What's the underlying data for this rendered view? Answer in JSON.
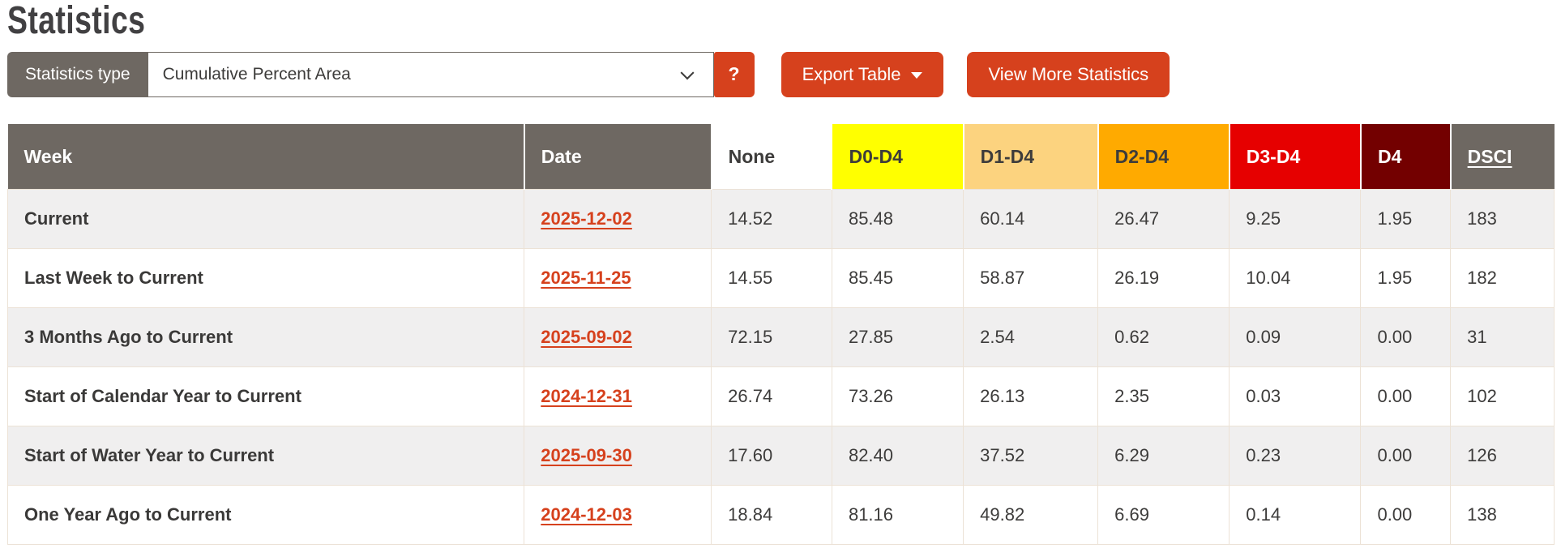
{
  "page": {
    "title": "Statistics"
  },
  "controls": {
    "statistics_type_label": "Statistics type",
    "statistics_type_value": "Cumulative Percent Area",
    "help_label": "?",
    "export_label": "Export Table",
    "view_more_label": "View More Statistics"
  },
  "icons": {
    "select_chevron": "chevron-down",
    "export_caret": "caret-down"
  },
  "colors": {
    "accent": "#d6411d",
    "header_gray": "#6e6862",
    "row_alt": "#f0efef",
    "border": "#ece2d6",
    "text": "#3d3c3b",
    "d0_yellow": "#ffff00",
    "d1_tan": "#fcd37f",
    "d2_orange": "#ffaa00",
    "d3_red": "#e60000",
    "d4_darkred": "#730000"
  },
  "table": {
    "columns": [
      {
        "key": "week",
        "label": "Week",
        "header_bg": "#6e6862",
        "header_fg": "#ffffff"
      },
      {
        "key": "date",
        "label": "Date",
        "header_bg": "#6e6862",
        "header_fg": "#ffffff"
      },
      {
        "key": "none",
        "label": "None",
        "header_bg": "#ffffff",
        "header_fg": "#3d3c3b"
      },
      {
        "key": "d0_d4",
        "label": "D0-D4",
        "header_bg": "#ffff00",
        "header_fg": "#3d3c3b"
      },
      {
        "key": "d1_d4",
        "label": "D1-D4",
        "header_bg": "#fcd37f",
        "header_fg": "#3d3c3b"
      },
      {
        "key": "d2_d4",
        "label": "D2-D4",
        "header_bg": "#ffaa00",
        "header_fg": "#3d3c3b"
      },
      {
        "key": "d3_d4",
        "label": "D3-D4",
        "header_bg": "#e60000",
        "header_fg": "#ffffff"
      },
      {
        "key": "d4",
        "label": "D4",
        "header_bg": "#730000",
        "header_fg": "#ffffff"
      },
      {
        "key": "dsci",
        "label": "DSCI",
        "header_bg": "#6e6862",
        "header_fg": "#ffffff",
        "link": true
      }
    ],
    "rows": [
      {
        "week": "Current",
        "date": "2025-12-02",
        "none": "14.52",
        "d0_d4": "85.48",
        "d1_d4": "60.14",
        "d2_d4": "26.47",
        "d3_d4": "9.25",
        "d4": "1.95",
        "dsci": "183"
      },
      {
        "week": "Last Week to Current",
        "date": "2025-11-25",
        "none": "14.55",
        "d0_d4": "85.45",
        "d1_d4": "58.87",
        "d2_d4": "26.19",
        "d3_d4": "10.04",
        "d4": "1.95",
        "dsci": "182"
      },
      {
        "week": "3 Months Ago to Current",
        "date": "2025-09-02",
        "none": "72.15",
        "d0_d4": "27.85",
        "d1_d4": "2.54",
        "d2_d4": "0.62",
        "d3_d4": "0.09",
        "d4": "0.00",
        "dsci": "31"
      },
      {
        "week": "Start of Calendar Year to Current",
        "date": "2024-12-31",
        "none": "26.74",
        "d0_d4": "73.26",
        "d1_d4": "26.13",
        "d2_d4": "2.35",
        "d3_d4": "0.03",
        "d4": "0.00",
        "dsci": "102"
      },
      {
        "week": "Start of Water Year to Current",
        "date": "2025-09-30",
        "none": "17.60",
        "d0_d4": "82.40",
        "d1_d4": "37.52",
        "d2_d4": "6.29",
        "d3_d4": "0.23",
        "d4": "0.00",
        "dsci": "126"
      },
      {
        "week": "One Year Ago to Current",
        "date": "2024-12-03",
        "none": "18.84",
        "d0_d4": "81.16",
        "d1_d4": "49.82",
        "d2_d4": "6.69",
        "d3_d4": "0.14",
        "d4": "0.00",
        "dsci": "138"
      }
    ]
  }
}
